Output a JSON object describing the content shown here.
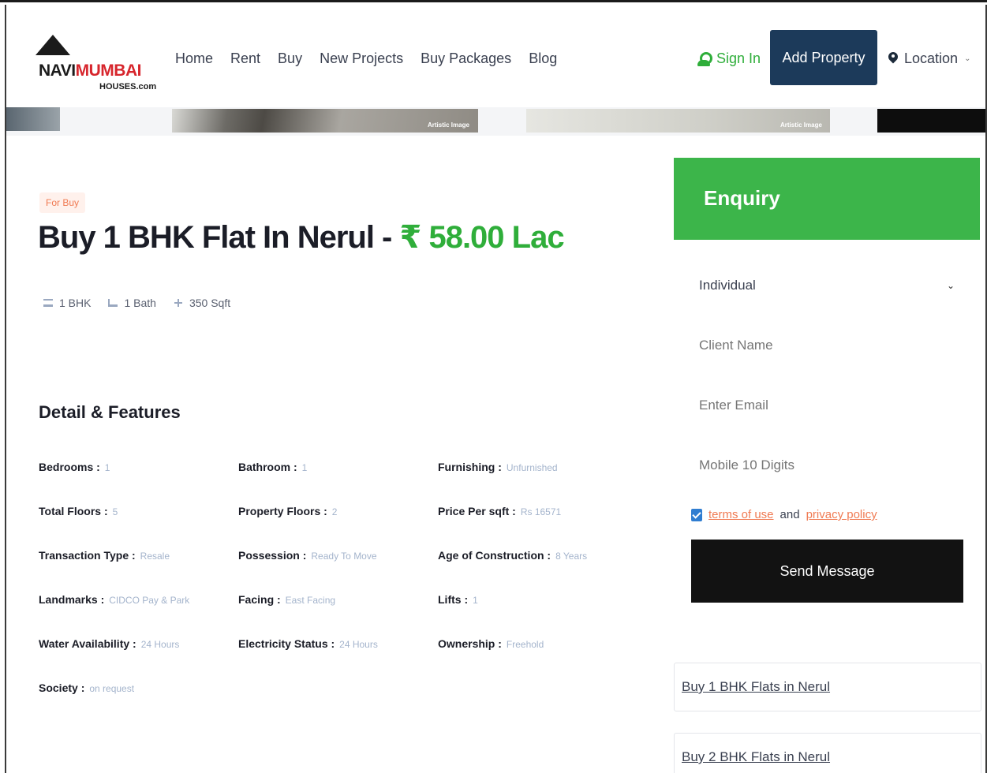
{
  "logo": {
    "line1_part1": "NAVI",
    "line1_part2": "MUMBAI",
    "line2": "HOUSES.com"
  },
  "nav": {
    "items": [
      "Home",
      "Rent",
      "Buy",
      "New Projects",
      "Buy Packages",
      "Blog"
    ]
  },
  "header": {
    "signin_label": "Sign In",
    "add_property_label": "Add Property",
    "location_label": "Location"
  },
  "strip": {
    "tag1": "Artistic Image",
    "tag2": "Artistic Image"
  },
  "listing": {
    "badge": "For Buy",
    "title": "Buy 1 BHK Flat In Nerul - ",
    "price": "₹ 58.00 Lac",
    "bhk": "1 BHK",
    "bath": "1 Bath",
    "area": "350 Sqft"
  },
  "details": {
    "section_title": "Detail & Features",
    "features": [
      {
        "label": "Bedrooms :",
        "value": "1"
      },
      {
        "label": "Bathroom :",
        "value": "1"
      },
      {
        "label": "Furnishing :",
        "value": "Unfurnished"
      },
      {
        "label": "Total Floors :",
        "value": "5"
      },
      {
        "label": "Property Floors :",
        "value": "2"
      },
      {
        "label": "Price Per sqft :",
        "value": "Rs 16571"
      },
      {
        "label": "Transaction Type :",
        "value": "Resale"
      },
      {
        "label": "Possession :",
        "value": "Ready To Move"
      },
      {
        "label": "Age of Construction :",
        "value": "8 Years"
      },
      {
        "label": "Landmarks :",
        "value": "CIDCO Pay & Park"
      },
      {
        "label": "Facing :",
        "value": "East Facing"
      },
      {
        "label": "Lifts :",
        "value": "1"
      },
      {
        "label": "Water Availability :",
        "value": "24 Hours"
      },
      {
        "label": "Electricity Status :",
        "value": "24 Hours"
      },
      {
        "label": "Ownership :",
        "value": "Freehold"
      },
      {
        "label": "Society :",
        "value": "on request"
      }
    ]
  },
  "enquiry": {
    "title": "Enquiry",
    "type_selected": "Individual",
    "name_placeholder": "Client Name",
    "email_placeholder": "Enter Email",
    "mobile_placeholder": "Mobile 10 Digits",
    "terms_link": "terms of use",
    "terms_and": "and",
    "privacy_link": "privacy policy",
    "send_label": "Send Message"
  },
  "related": [
    "Buy 1 BHK Flats in Nerul",
    "Buy 2 BHK Flats in Nerul"
  ],
  "colors": {
    "accent_green": "#3cb54a",
    "navy": "#1c3a5a",
    "orange": "#f07a52"
  }
}
